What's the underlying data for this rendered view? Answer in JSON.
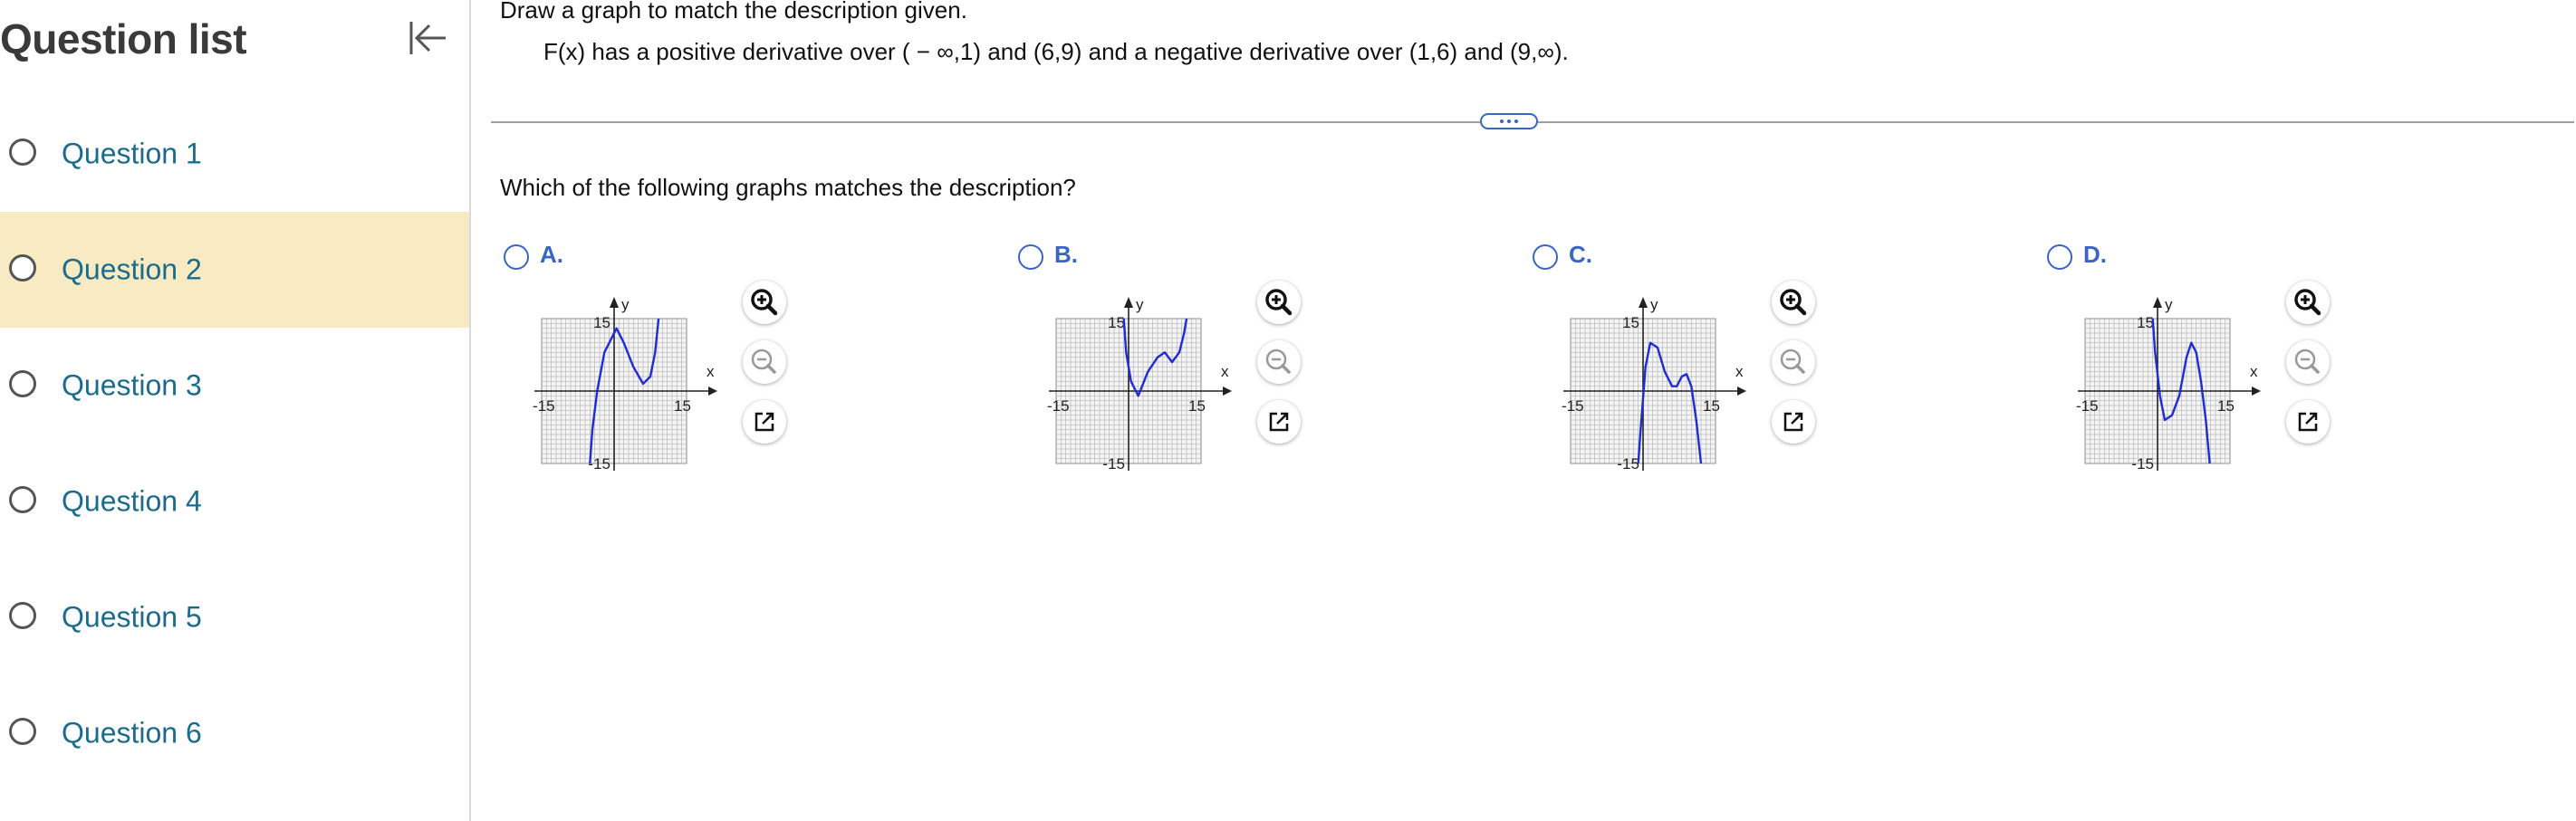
{
  "sidebar": {
    "title": "Question list",
    "collapse_icon": "collapse-left-icon",
    "items": [
      {
        "label": "Question 1",
        "active": false
      },
      {
        "label": "Question 2",
        "active": true
      },
      {
        "label": "Question 3",
        "active": false
      },
      {
        "label": "Question 4",
        "active": false
      },
      {
        "label": "Question 5",
        "active": false
      },
      {
        "label": "Question 6",
        "active": false
      }
    ]
  },
  "main": {
    "instructions": "Draw a graph to match the description given.",
    "description": "F(x) has a positive derivative over ( − ∞,1) and (6,9) and a negative derivative over (1,6) and (9,∞).",
    "more_icon": "ellipsis-icon",
    "question": "Which of the following graphs matches the description?",
    "colors": {
      "link": "#1b6c8c",
      "accent": "#3a65c4",
      "active_bg": "#f8ebc3",
      "curve": "#1f2bd6"
    },
    "graph_labels": {
      "x_axis": "x",
      "y_axis": "y",
      "max": "15",
      "min": "-15",
      "max_right": "15"
    },
    "options": [
      {
        "label": "A.",
        "icons": [
          "zoom-in-icon",
          "zoom-out-icon",
          "open-external-icon"
        ]
      },
      {
        "label": "B.",
        "icons": [
          "zoom-in-icon",
          "zoom-out-icon",
          "open-external-icon"
        ]
      },
      {
        "label": "C.",
        "icons": [
          "zoom-in-icon",
          "zoom-out-icon",
          "open-external-icon"
        ]
      },
      {
        "label": "D.",
        "icons": [
          "zoom-in-icon",
          "zoom-out-icon",
          "open-external-icon"
        ]
      }
    ]
  }
}
